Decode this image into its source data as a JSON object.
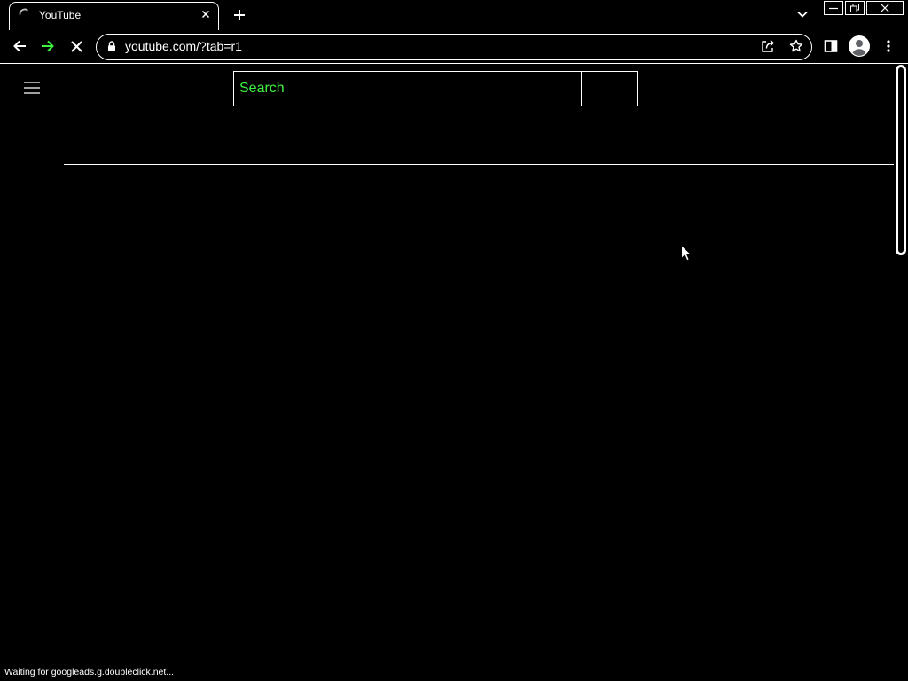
{
  "colors": {
    "background": "#000000",
    "foreground": "#ffffff",
    "border": "#ffffff",
    "disabled_text": "#3ff23f"
  },
  "browser": {
    "tabs": [
      {
        "title": "YouTube",
        "favicon_icon": "loading-spinner-icon",
        "close_icon": "close-icon"
      }
    ],
    "new_tab_icon": "plus-icon",
    "tab_search_icon": "chevron-down-icon",
    "window_controls": {
      "minimize_icon": "minimize-icon",
      "restore_icon": "restore-icon",
      "close_icon": "close-icon"
    },
    "toolbar": {
      "back_icon": "arrow-left-icon",
      "forward_icon": "arrow-right-icon",
      "stop_icon": "stop-icon",
      "address_bar": {
        "site_info_icon": "lock-icon",
        "url": "youtube.com/?tab=r1",
        "share_icon": "share-icon",
        "bookmark_icon": "star-icon"
      },
      "side_panel_icon": "side-panel-icon",
      "profile_icon": "avatar-icon",
      "menu_icon": "more-vertical-icon"
    },
    "status_text": "Waiting for googleads.g.doubleclick.net..."
  },
  "page": {
    "guide_icon": "hamburger-menu-icon",
    "search": {
      "placeholder": "Search"
    }
  }
}
